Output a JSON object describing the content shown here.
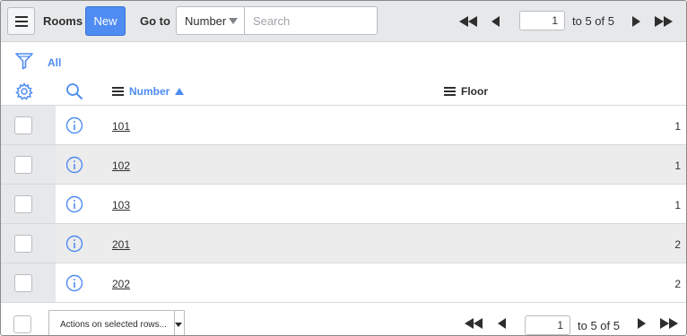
{
  "header": {
    "menu_icon": "hamburger-menu-icon",
    "title": "Rooms",
    "new_label": "New",
    "goto_label": "Go to",
    "goto_field": "Number",
    "search_placeholder": "Search"
  },
  "pager": {
    "page_value": "1",
    "count_label": "to 5 of 5"
  },
  "filter": {
    "icon": "funnel-filter-icon",
    "all_label": "All"
  },
  "columns": {
    "settings_icon": "gear-icon",
    "search_icon": "magnifier-icon",
    "number_label": "Number",
    "floor_label": "Floor",
    "sort": "ascending"
  },
  "rows": [
    {
      "number": "101",
      "floor": "1"
    },
    {
      "number": "102",
      "floor": "1"
    },
    {
      "number": "103",
      "floor": "1"
    },
    {
      "number": "201",
      "floor": "2"
    },
    {
      "number": "202",
      "floor": "2"
    }
  ],
  "footer": {
    "actions_label": "Actions on selected rows...",
    "page_value": "1",
    "count_label": "to 5 of 5"
  },
  "colors": {
    "accent": "#4e8cf2",
    "header_bg": "#e6e8ea",
    "row_alt_bg": "#ececec"
  }
}
